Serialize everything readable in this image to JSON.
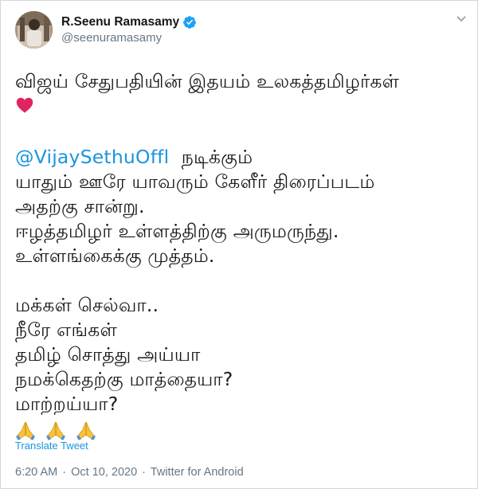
{
  "author": {
    "display_name": "R.Seenu Ramasamy",
    "handle": "@seenuramasamy",
    "verified_icon": "verified-badge-icon",
    "verified_color": "#1da1f2"
  },
  "tweet": {
    "line1": "விஜய் சேதுபதியின் இதயம் உலகத்தமிழர்கள்",
    "heart_icon": "red-heart-emoji",
    "mention": "@VijaySethuOffl",
    "mention_suffix": "  நடிக்கும்",
    "line3": "யாதும் ஊரே யாவரும் கேளீர் திரைப்படம்",
    "line4": "அதற்கு சான்று.",
    "line5": "ஈழத்தமிழர் உள்ளத்திற்கு அருமருந்து.",
    "line6": "உள்ளங்கைக்கு முத்தம்.",
    "line7": "மக்கள் செல்வா..",
    "line8": "நீரே எங்கள்",
    "line9": "தமிழ் சொத்து அய்யா",
    "line10": "நமக்கெதற்கு மாத்தையா?",
    "line11": "மாற்றய்யா?",
    "emoji_icon": "folded-hands-emoji",
    "emoji_count": 3
  },
  "translate_label": "Translate Tweet",
  "meta": {
    "time": "6:20 AM",
    "separator": "·",
    "date": "Oct 10, 2020",
    "source": "Twitter for Android"
  },
  "colors": {
    "link": "#1b95e0",
    "secondary": "#657786",
    "heart": "#e0245e"
  }
}
